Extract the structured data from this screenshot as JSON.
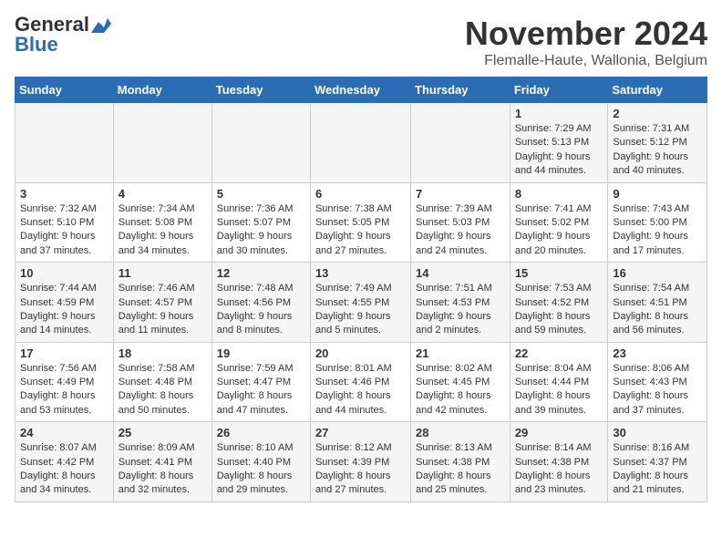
{
  "logo": {
    "general": "General",
    "blue": "Blue"
  },
  "title": "November 2024",
  "location": "Flemalle-Haute, Wallonia, Belgium",
  "headers": [
    "Sunday",
    "Monday",
    "Tuesday",
    "Wednesday",
    "Thursday",
    "Friday",
    "Saturday"
  ],
  "weeks": [
    [
      {
        "day": "",
        "info": ""
      },
      {
        "day": "",
        "info": ""
      },
      {
        "day": "",
        "info": ""
      },
      {
        "day": "",
        "info": ""
      },
      {
        "day": "",
        "info": ""
      },
      {
        "day": "1",
        "info": "Sunrise: 7:29 AM\nSunset: 5:13 PM\nDaylight: 9 hours and 44 minutes."
      },
      {
        "day": "2",
        "info": "Sunrise: 7:31 AM\nSunset: 5:12 PM\nDaylight: 9 hours and 40 minutes."
      }
    ],
    [
      {
        "day": "3",
        "info": "Sunrise: 7:32 AM\nSunset: 5:10 PM\nDaylight: 9 hours and 37 minutes."
      },
      {
        "day": "4",
        "info": "Sunrise: 7:34 AM\nSunset: 5:08 PM\nDaylight: 9 hours and 34 minutes."
      },
      {
        "day": "5",
        "info": "Sunrise: 7:36 AM\nSunset: 5:07 PM\nDaylight: 9 hours and 30 minutes."
      },
      {
        "day": "6",
        "info": "Sunrise: 7:38 AM\nSunset: 5:05 PM\nDaylight: 9 hours and 27 minutes."
      },
      {
        "day": "7",
        "info": "Sunrise: 7:39 AM\nSunset: 5:03 PM\nDaylight: 9 hours and 24 minutes."
      },
      {
        "day": "8",
        "info": "Sunrise: 7:41 AM\nSunset: 5:02 PM\nDaylight: 9 hours and 20 minutes."
      },
      {
        "day": "9",
        "info": "Sunrise: 7:43 AM\nSunset: 5:00 PM\nDaylight: 9 hours and 17 minutes."
      }
    ],
    [
      {
        "day": "10",
        "info": "Sunrise: 7:44 AM\nSunset: 4:59 PM\nDaylight: 9 hours and 14 minutes."
      },
      {
        "day": "11",
        "info": "Sunrise: 7:46 AM\nSunset: 4:57 PM\nDaylight: 9 hours and 11 minutes."
      },
      {
        "day": "12",
        "info": "Sunrise: 7:48 AM\nSunset: 4:56 PM\nDaylight: 9 hours and 8 minutes."
      },
      {
        "day": "13",
        "info": "Sunrise: 7:49 AM\nSunset: 4:55 PM\nDaylight: 9 hours and 5 minutes."
      },
      {
        "day": "14",
        "info": "Sunrise: 7:51 AM\nSunset: 4:53 PM\nDaylight: 9 hours and 2 minutes."
      },
      {
        "day": "15",
        "info": "Sunrise: 7:53 AM\nSunset: 4:52 PM\nDaylight: 8 hours and 59 minutes."
      },
      {
        "day": "16",
        "info": "Sunrise: 7:54 AM\nSunset: 4:51 PM\nDaylight: 8 hours and 56 minutes."
      }
    ],
    [
      {
        "day": "17",
        "info": "Sunrise: 7:56 AM\nSunset: 4:49 PM\nDaylight: 8 hours and 53 minutes."
      },
      {
        "day": "18",
        "info": "Sunrise: 7:58 AM\nSunset: 4:48 PM\nDaylight: 8 hours and 50 minutes."
      },
      {
        "day": "19",
        "info": "Sunrise: 7:59 AM\nSunset: 4:47 PM\nDaylight: 8 hours and 47 minutes."
      },
      {
        "day": "20",
        "info": "Sunrise: 8:01 AM\nSunset: 4:46 PM\nDaylight: 8 hours and 44 minutes."
      },
      {
        "day": "21",
        "info": "Sunrise: 8:02 AM\nSunset: 4:45 PM\nDaylight: 8 hours and 42 minutes."
      },
      {
        "day": "22",
        "info": "Sunrise: 8:04 AM\nSunset: 4:44 PM\nDaylight: 8 hours and 39 minutes."
      },
      {
        "day": "23",
        "info": "Sunrise: 8:06 AM\nSunset: 4:43 PM\nDaylight: 8 hours and 37 minutes."
      }
    ],
    [
      {
        "day": "24",
        "info": "Sunrise: 8:07 AM\nSunset: 4:42 PM\nDaylight: 8 hours and 34 minutes."
      },
      {
        "day": "25",
        "info": "Sunrise: 8:09 AM\nSunset: 4:41 PM\nDaylight: 8 hours and 32 minutes."
      },
      {
        "day": "26",
        "info": "Sunrise: 8:10 AM\nSunset: 4:40 PM\nDaylight: 8 hours and 29 minutes."
      },
      {
        "day": "27",
        "info": "Sunrise: 8:12 AM\nSunset: 4:39 PM\nDaylight: 8 hours and 27 minutes."
      },
      {
        "day": "28",
        "info": "Sunrise: 8:13 AM\nSunset: 4:38 PM\nDaylight: 8 hours and 25 minutes."
      },
      {
        "day": "29",
        "info": "Sunrise: 8:14 AM\nSunset: 4:38 PM\nDaylight: 8 hours and 23 minutes."
      },
      {
        "day": "30",
        "info": "Sunrise: 8:16 AM\nSunset: 4:37 PM\nDaylight: 8 hours and 21 minutes."
      }
    ]
  ]
}
